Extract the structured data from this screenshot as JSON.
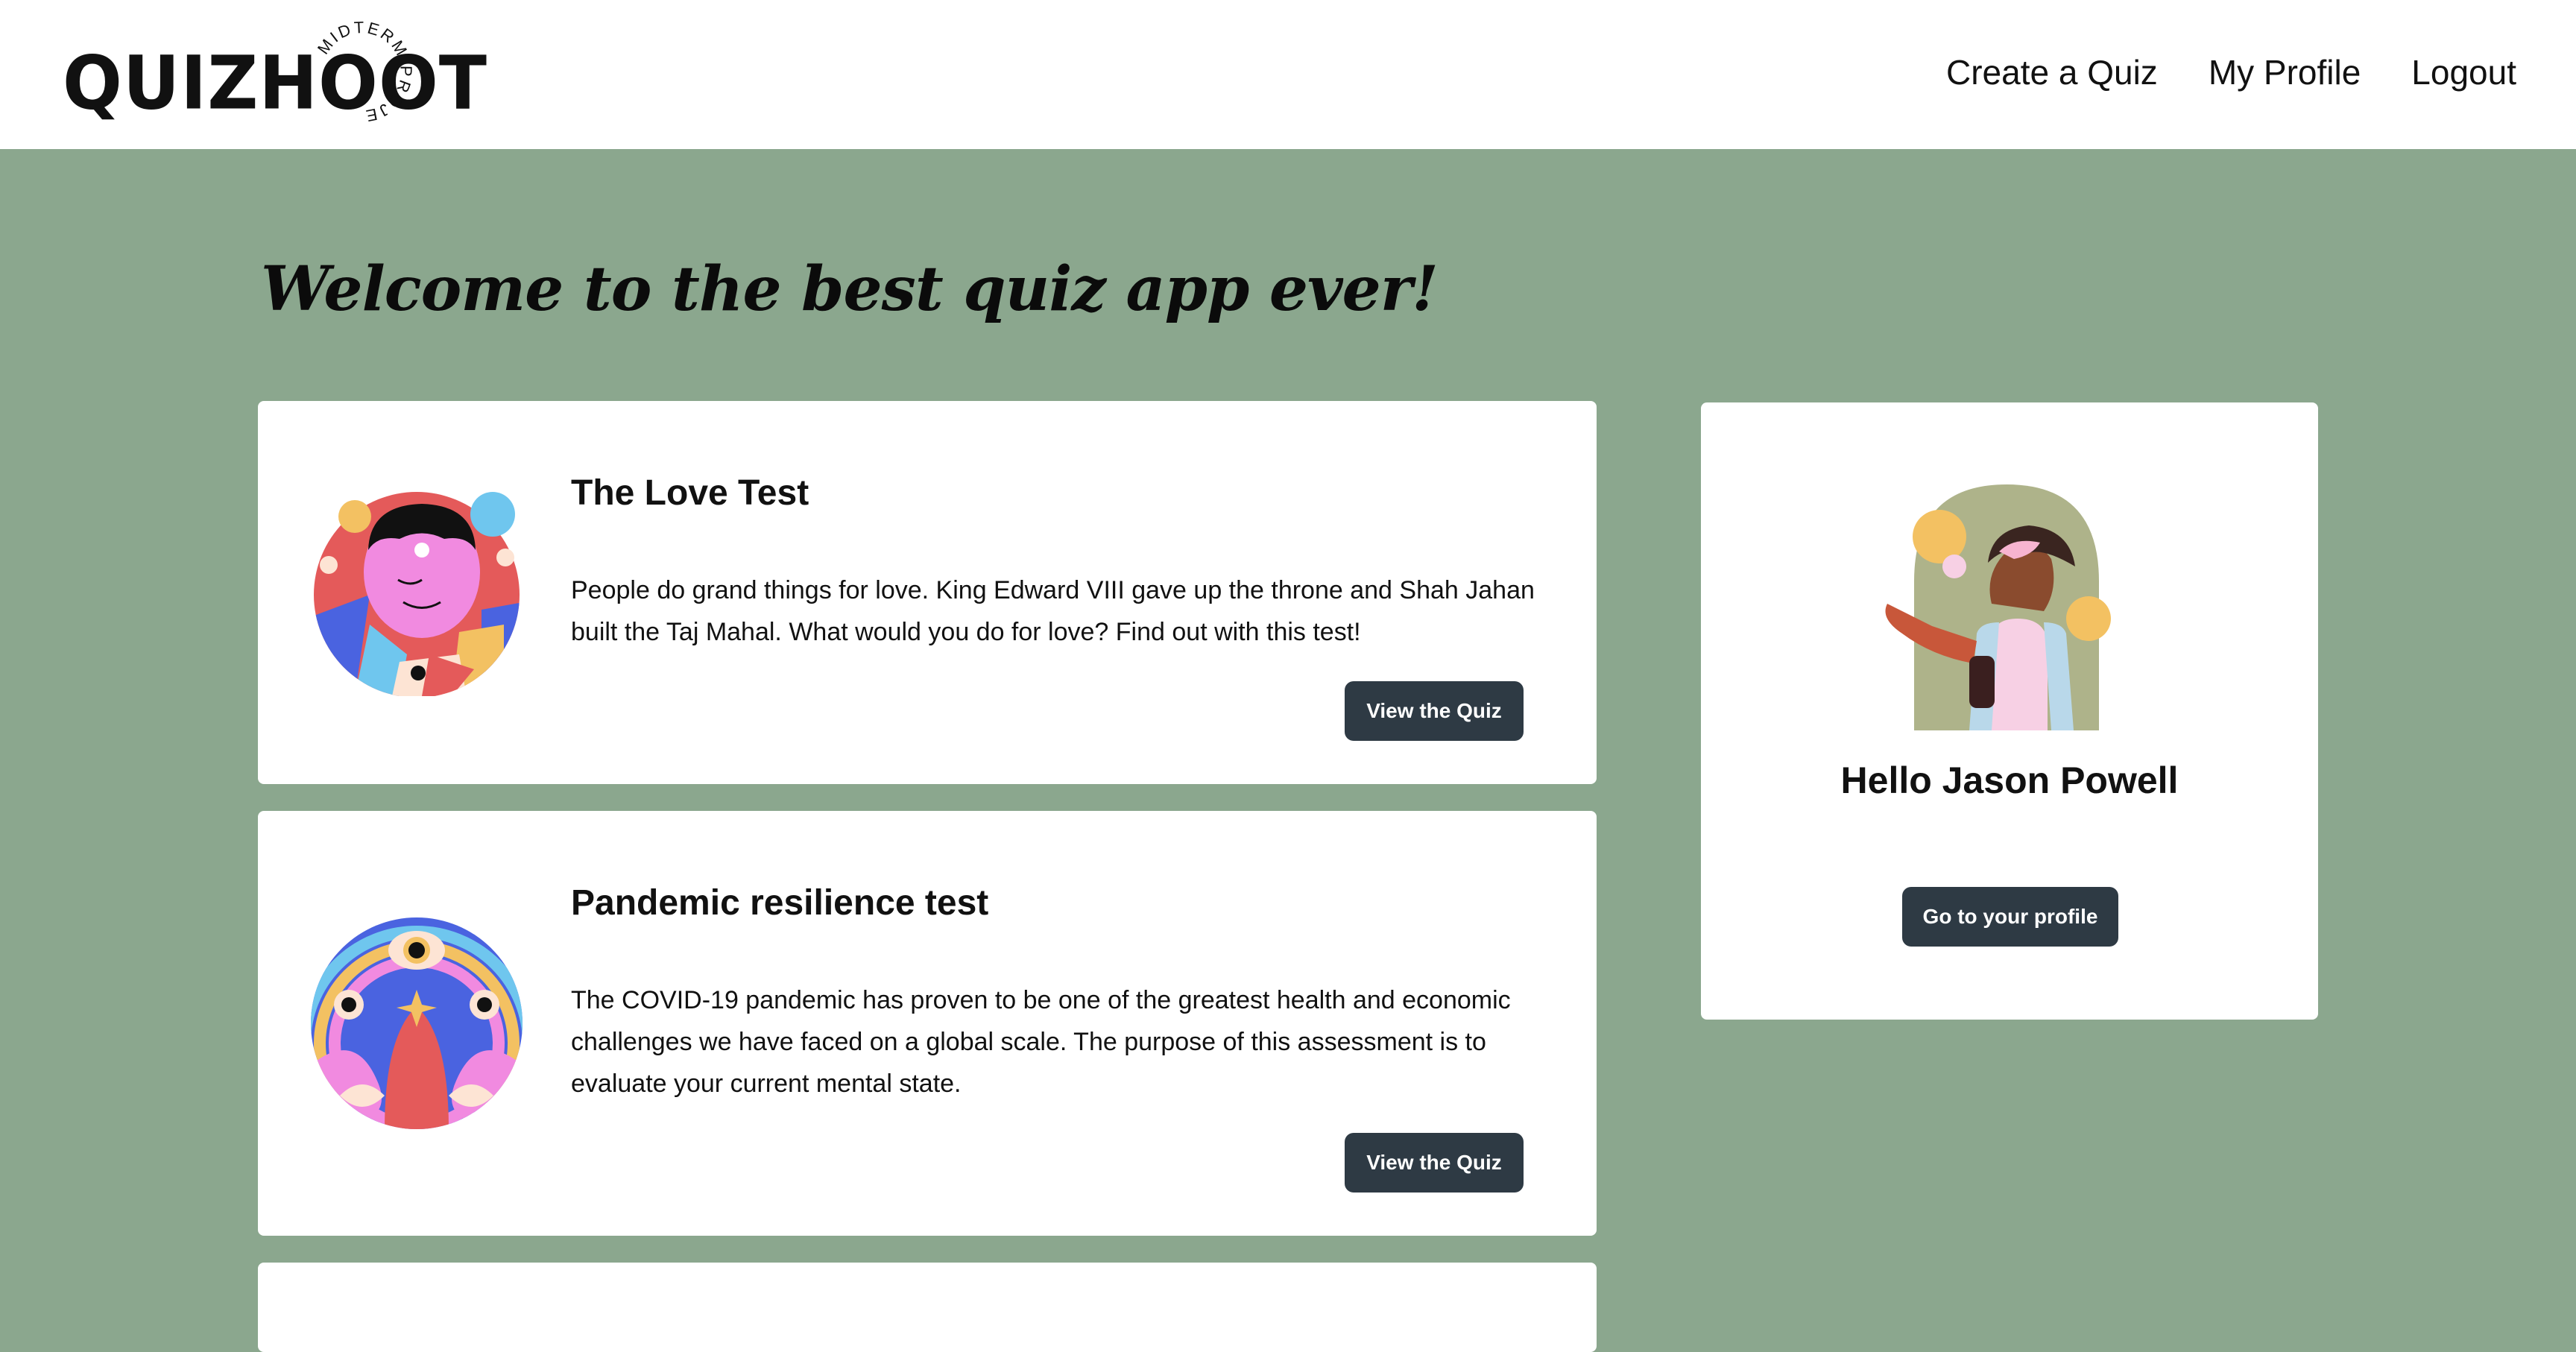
{
  "header": {
    "logo_text": "QUIZHOOT",
    "logo_badge_text": "MIDTERM PROJECT",
    "nav": [
      {
        "label": "Create a Quiz"
      },
      {
        "label": "My Profile"
      },
      {
        "label": "Logout"
      }
    ]
  },
  "main": {
    "welcome_title": "Welcome to the best quiz app ever!",
    "quizzes": [
      {
        "title": "The Love Test",
        "description": "People do grand things for love. King Edward VIII gave up the throne and Shah Jahan built the Taj Mahal. What would you do for love? Find out with this test!",
        "button_label": "View the Quiz",
        "icon": "love-character-illustration"
      },
      {
        "title": "Pandemic resilience test",
        "description": "The COVID-19 pandemic has proven to be one of the greatest health and economic challenges we have faced on a global scale. The purpose of this assessment is to evaluate your current mental state.",
        "button_label": "View the Quiz",
        "icon": "mystic-eyes-illustration"
      }
    ]
  },
  "profile": {
    "greeting": "Hello Jason Powell",
    "button_label": "Go to your profile",
    "icon": "waving-person-illustration"
  },
  "colors": {
    "background": "#8ba78e",
    "button": "#2e3a44",
    "card": "#ffffff"
  }
}
